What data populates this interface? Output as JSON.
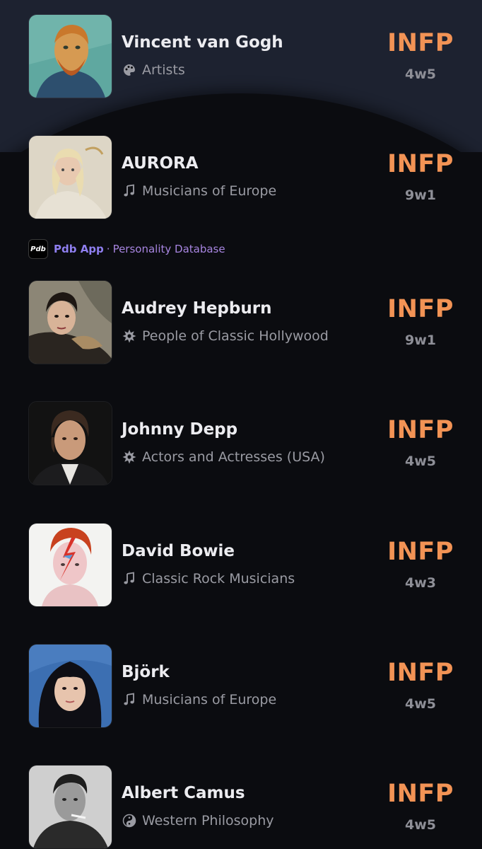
{
  "ad": {
    "logo_text": "Pdb",
    "app_name": "Pdb App",
    "separator": "·",
    "description": "Personality Database"
  },
  "items": [
    {
      "name": "Vincent van Gogh",
      "category": "Artists",
      "category_icon": "palette-icon",
      "mbti": "INFP",
      "enneagram": "4w5"
    },
    {
      "name": "AURORA",
      "category": "Musicians of Europe",
      "category_icon": "music-note-icon",
      "mbti": "INFP",
      "enneagram": "9w1"
    },
    {
      "name": "Audrey Hepburn",
      "category": "People of Classic Hollywood",
      "category_icon": "starburst-icon",
      "mbti": "INFP",
      "enneagram": "9w1"
    },
    {
      "name": "Johnny Depp",
      "category": "Actors and Actresses (USA)",
      "category_icon": "starburst-icon",
      "mbti": "INFP",
      "enneagram": "4w5"
    },
    {
      "name": "David Bowie",
      "category": "Classic Rock Musicians",
      "category_icon": "music-note-icon",
      "mbti": "INFP",
      "enneagram": "4w3"
    },
    {
      "name": "Björk",
      "category": "Musicians of Europe",
      "category_icon": "music-note-icon",
      "mbti": "INFP",
      "enneagram": "4w5"
    },
    {
      "name": "Albert Camus",
      "category": "Western Philosophy",
      "category_icon": "yin-yang-icon",
      "mbti": "INFP",
      "enneagram": "4w5"
    }
  ],
  "colors": {
    "background": "#0b0c10",
    "top_band": "#1d2230",
    "mbti": "#f29355",
    "ad_app": "#8f7ff0",
    "ad_text": "#a785e0"
  }
}
